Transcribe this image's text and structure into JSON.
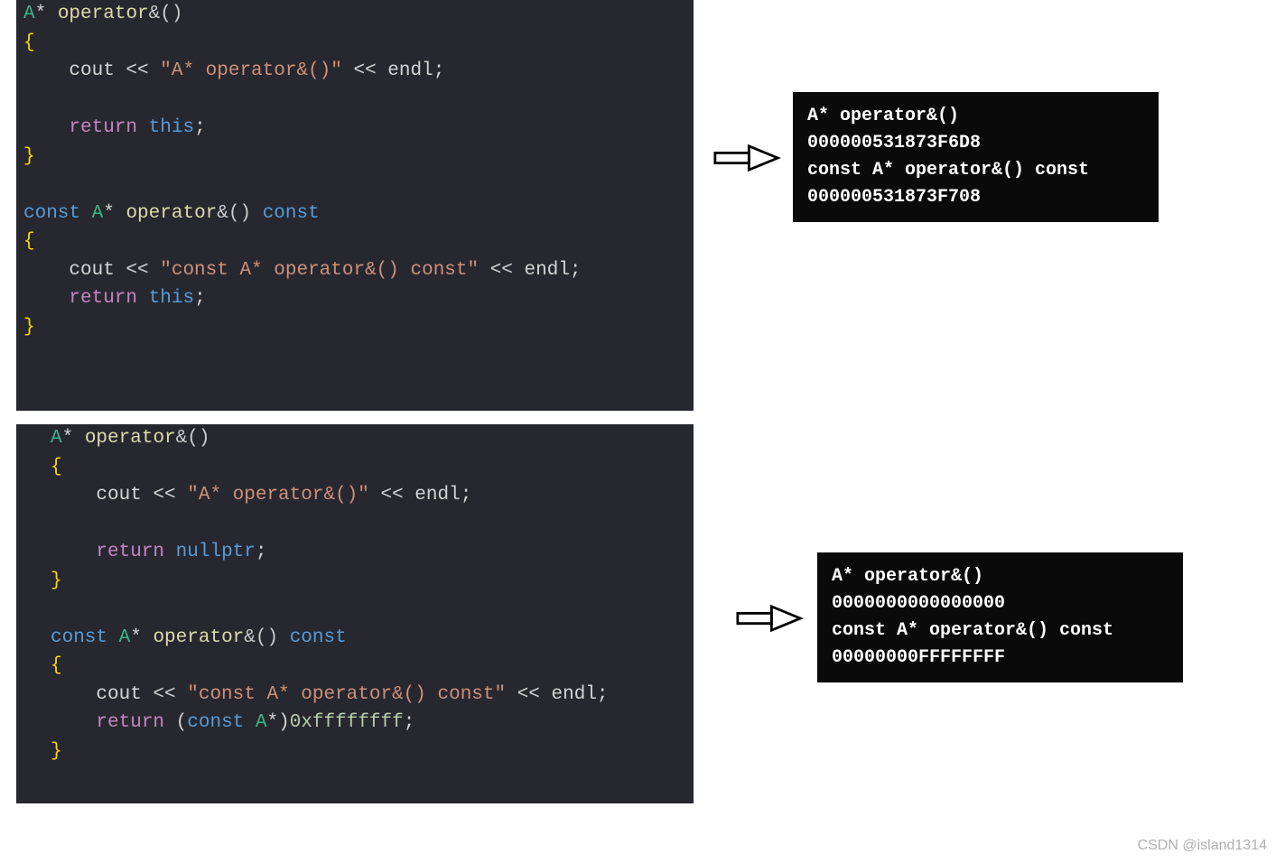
{
  "code1": {
    "l1a": "A",
    "l1b": "* ",
    "l1c": "operator",
    "l1d": "&()",
    "l2": "{",
    "l3a": "    cout ",
    "l3b": "<<",
    "l3c": " \"A* operator&()\" ",
    "l3d": "<<",
    "l3e": " endl;",
    "l4a": "    ",
    "l4b": "return",
    "l4c": " ",
    "l4d": "this",
    "l4e": ";",
    "l5": "}",
    "l6a": "const",
    "l6b": " ",
    "l6c": "A",
    "l6d": "* ",
    "l6e": "operator",
    "l6f": "&() ",
    "l6g": "const",
    "l7": "{",
    "l8a": "    cout ",
    "l8b": "<<",
    "l8c": " \"const A* operator&() const\" ",
    "l8d": "<<",
    "l8e": " endl;",
    "l9a": "    ",
    "l9b": "return",
    "l9c": " ",
    "l9d": "this",
    "l9e": ";",
    "l10": "}"
  },
  "code2": {
    "l1a": "A",
    "l1b": "* ",
    "l1c": "operator",
    "l1d": "&()",
    "l2": "{",
    "l3a": "    cout ",
    "l3b": "<<",
    "l3c": " \"A* operator&()\" ",
    "l3d": "<<",
    "l3e": " endl;",
    "l4a": "    ",
    "l4b": "return",
    "l4c": " ",
    "l4d": "nullptr",
    "l4e": ";",
    "l5": "}",
    "l6a": "const",
    "l6b": " ",
    "l6c": "A",
    "l6d": "* ",
    "l6e": "operator",
    "l6f": "&() ",
    "l6g": "const",
    "l7": "{",
    "l8a": "    cout ",
    "l8b": "<<",
    "l8c": " \"const A* operator&() const\" ",
    "l8d": "<<",
    "l8e": " endl;",
    "l9a": "    ",
    "l9b": "return",
    "l9c": " (",
    "l9d": "const",
    "l9e": " ",
    "l9f": "A",
    "l9g": "*)",
    "l9h": "0xffffffff",
    "l9i": ";",
    "l10": "}"
  },
  "output1": "A* operator&()\n000000531873F6D8\nconst A* operator&() const\n000000531873F708",
  "output2": "A* operator&()\n0000000000000000\nconst A* operator&() const\n00000000FFFFFFFF",
  "watermark": "CSDN @island1314"
}
